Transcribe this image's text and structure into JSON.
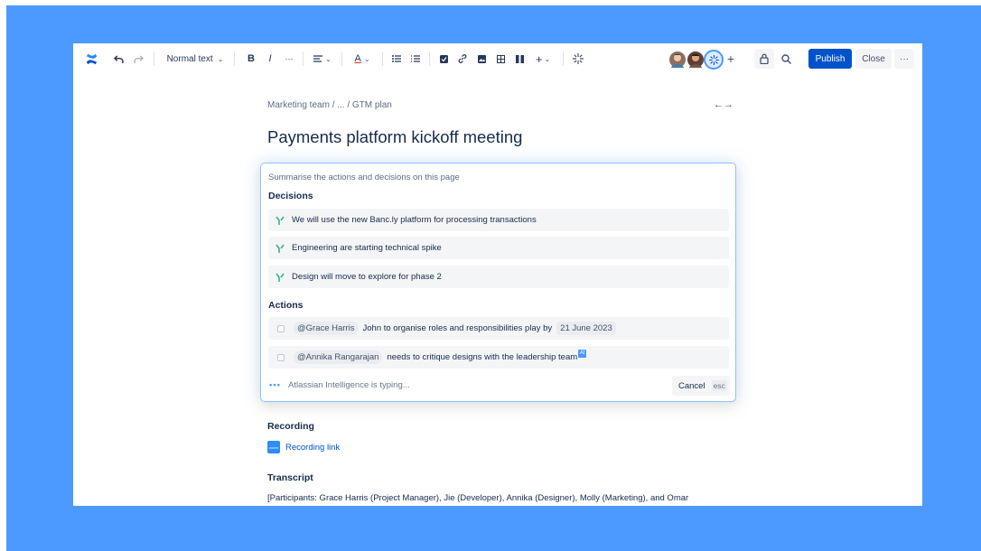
{
  "toolbar": {
    "text_style": "Normal text",
    "bold_label": "B",
    "italic_label": "I",
    "more_format": "···",
    "publish_label": "Publish",
    "close_label": "Close",
    "more_label": "···"
  },
  "breadcrumb": {
    "text": "Marketing team  /  ...  /  GTM plan"
  },
  "page": {
    "title": "Payments platform kickoff meeting"
  },
  "ai_panel": {
    "prompt": "Summarise the actions and decisions on this page",
    "decisions_heading": "Decisions",
    "decisions": [
      "We will use the new Banc.ly platform for processing transactions",
      "Engineering are starting technical spike",
      "Design will move to explore for phase 2"
    ],
    "actions_heading": "Actions",
    "actions": [
      {
        "mention": "@Grace Harris",
        "text": "John to organise roles and responsibilities play by",
        "date": "21 June 2023"
      },
      {
        "mention": "@Annika Rangarajan",
        "text": "needs to critique designs with the leadership team",
        "badge": "AI"
      }
    ],
    "typing_status": "Atlassian Intelligence is typing...",
    "cancel_label": "Cancel",
    "cancel_shortcut": "esc"
  },
  "recording": {
    "heading": "Recording",
    "link_label": "Recording link",
    "icon_text": "zoom"
  },
  "transcript": {
    "heading": "Transcript",
    "text": "[Participants: Grace Harris (Project Manager), Jie (Developer),  Annika (Designer), Molly (Marketing), and  Omar"
  },
  "colors": {
    "frame_background": "#4c9aff",
    "primary_button": "#0052cc",
    "decision_icon": "#36b37e"
  }
}
